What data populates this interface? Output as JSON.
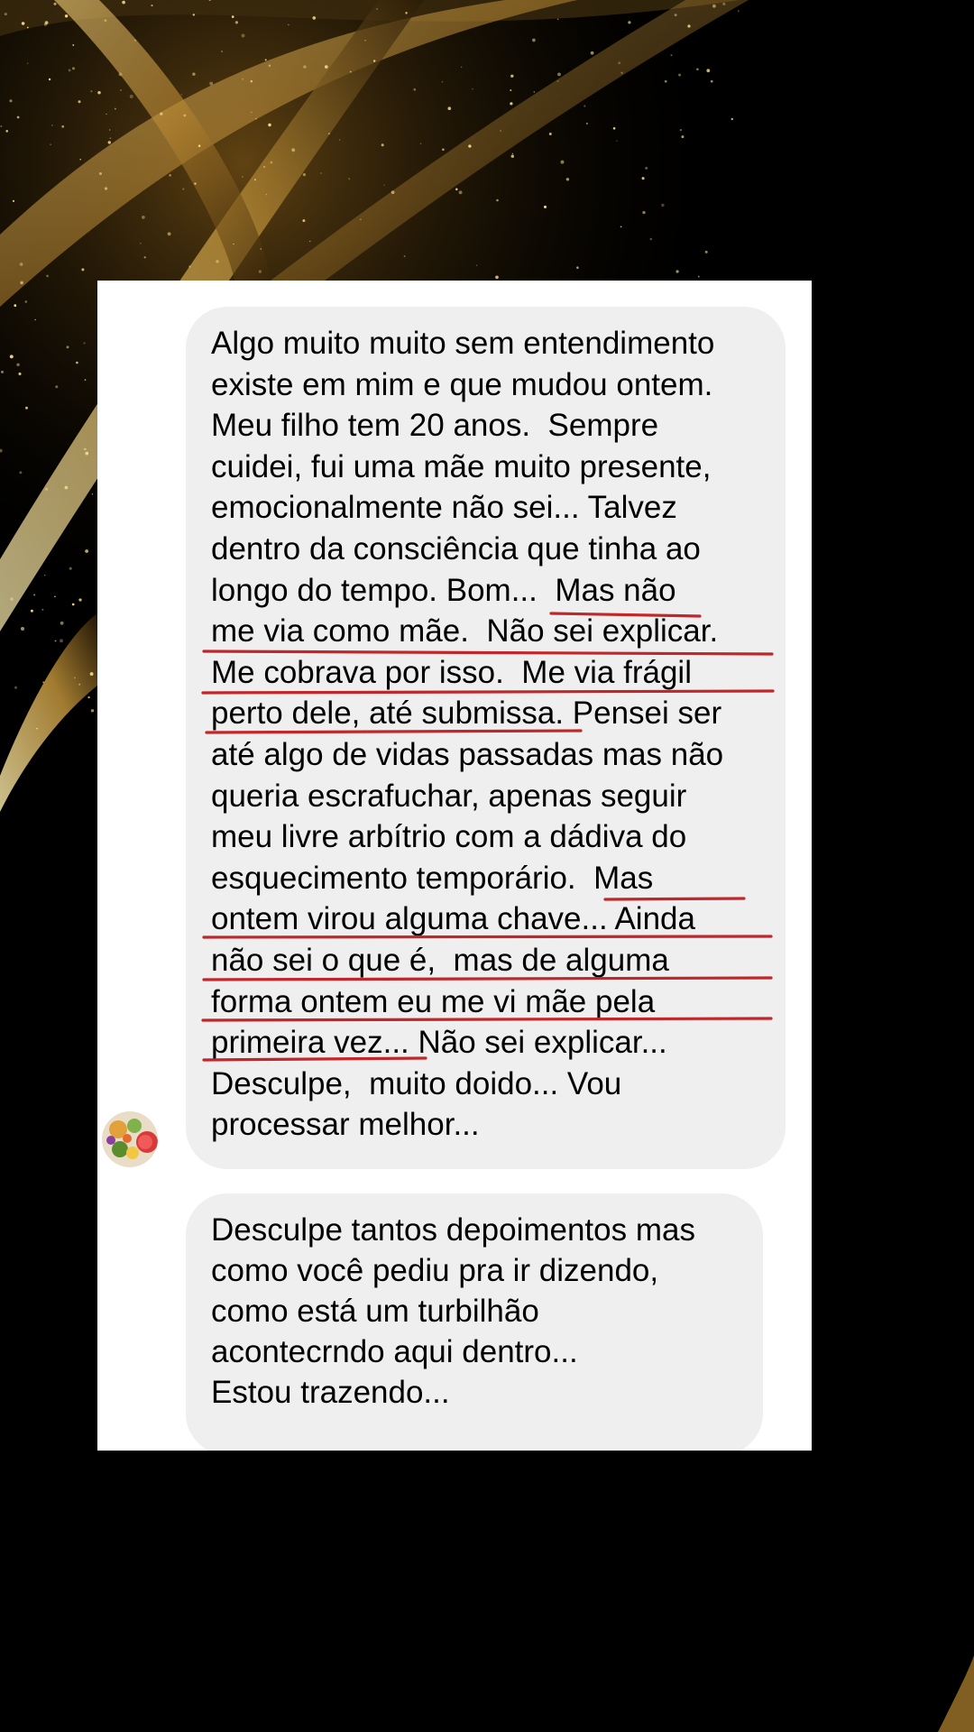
{
  "conversation": {
    "messages": [
      {
        "lines": [
          "Algo muito muito sem entendimento",
          "existe em mim e que mudou ontem.",
          "Meu filho tem 20 anos.  Sempre",
          "cuidei, fui uma mãe muito presente,",
          "emocionalmente não sei... Talvez",
          "dentro da consciência que tinha ao",
          "longo do tempo. Bom...  Mas não",
          "me via como mãe.  Não sei explicar.",
          "Me cobrava por isso.  Me via frágil",
          "perto dele, até submissa. Pensei ser",
          "até algo de vidas passadas mas não",
          "queria escrafuchar, apenas seguir",
          "meu livre arbítrio com a dádiva do",
          "esquecimento temporário.  Mas",
          "ontem virou alguma chave... Ainda",
          "não sei o que é,  mas de alguma",
          "forma ontem eu me vi mãe pela",
          "primeira vez... Não sei explicar...",
          "Desculpe,  muito doido... Vou",
          "processar melhor..."
        ]
      },
      {
        "lines": [
          "Desculpe tantos depoimentos mas",
          "como você pediu pra ir dizendo,",
          "como está um turbilhão",
          "acontecrndo aqui dentro...",
          "Estou trazendo..."
        ]
      }
    ],
    "sender_avatar": "fruit-bowl-avatar",
    "highlight_color": "#c0262a",
    "bubble_color": "#efefef",
    "background_accent": "#d4a640"
  }
}
